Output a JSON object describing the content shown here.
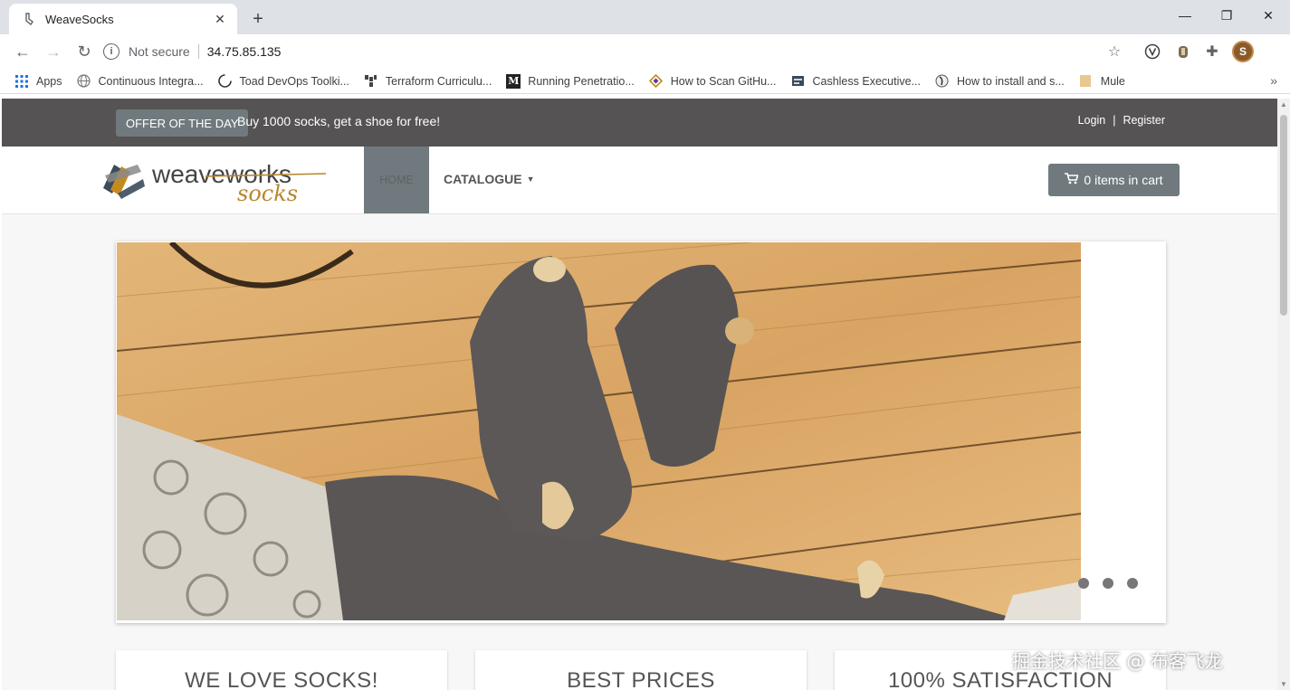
{
  "browser": {
    "tab_title": "WeaveSocks",
    "new_tab_symbol": "+",
    "security_label": "Not secure",
    "url": "34.75.85.135",
    "profile_initial": "S",
    "bookmarks": [
      {
        "label": "Apps",
        "icon": "apps-grid-icon"
      },
      {
        "label": "Continuous Integra...",
        "icon": "globe-icon"
      },
      {
        "label": "Toad DevOps Toolki...",
        "icon": "toad-icon"
      },
      {
        "label": "Terraform Curriculu...",
        "icon": "terraform-icon"
      },
      {
        "label": "Running Penetratio...",
        "icon": "medium-icon"
      },
      {
        "label": "How to Scan GitHu...",
        "icon": "diamond-icon"
      },
      {
        "label": "Cashless Executive...",
        "icon": "doc-icon"
      },
      {
        "label": "How to install and s...",
        "icon": "profile-icon"
      },
      {
        "label": "Mule",
        "icon": "folder-icon"
      }
    ]
  },
  "page": {
    "offer_button": "OFFER OF THE DAY",
    "offer_text": "Buy 1000 socks, get a shoe for free!",
    "login": "Login",
    "register": "Register",
    "auth_separator": "|",
    "logo_text_1": "weaveworks",
    "logo_text_2": "socks",
    "nav_home": "HOME",
    "nav_catalogue": "CATALOGUE",
    "cart_label": "0 items in cart",
    "carousel_dots": 3,
    "features": [
      "WE LOVE SOCKS!",
      "BEST PRICES",
      "100% SATISFACTION"
    ],
    "watermark": "掘金技术社区 @ 布客飞龙"
  },
  "colors": {
    "topbar": "#555353",
    "button_gray": "#707a7e",
    "wood": "#d9a868"
  }
}
